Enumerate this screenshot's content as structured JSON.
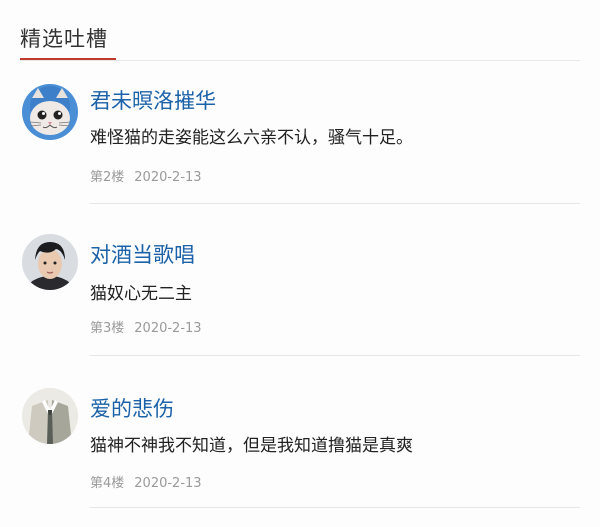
{
  "section": {
    "title": "精选吐槽",
    "accent_color": "#c0392b"
  },
  "comments": [
    {
      "username": "君未暝洛摧华",
      "text": "难怪猫的走姿能这么六亲不认，骚气十足。",
      "floor": "第2楼",
      "date": "2020-2-13",
      "avatar_icon": "cat-face-icon"
    },
    {
      "username": "对酒当歌唱",
      "text": "猫奴心无二主",
      "floor": "第3楼",
      "date": "2020-2-13",
      "avatar_icon": "portrait-icon"
    },
    {
      "username": "爱的悲伤",
      "text": "猫神不神我不知道，但是我知道撸猫是真爽",
      "floor": "第4楼",
      "date": "2020-2-13",
      "avatar_icon": "suit-figure-icon"
    }
  ],
  "colors": {
    "username": "#1b62a8",
    "meta": "#9a9a9a",
    "text": "#222222"
  }
}
